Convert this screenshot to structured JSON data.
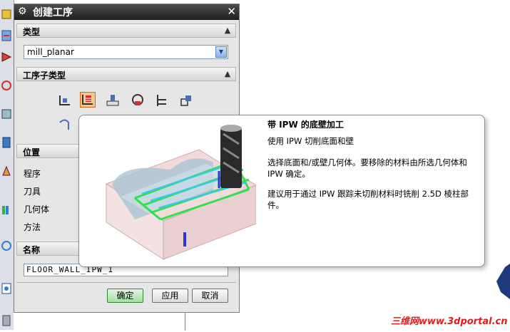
{
  "dialog": {
    "title": "创建工序",
    "type_section": {
      "label": "类型",
      "selected": "mill_planar"
    },
    "subtype_section": {
      "label": "工序子类型"
    },
    "location_section": {
      "label": "位置",
      "fields": [
        "程序",
        "刀具",
        "几何体",
        "方法"
      ]
    },
    "name_section": {
      "label": "名称",
      "value": "FLOOR_WALL_IPW_1"
    },
    "buttons": {
      "ok": "确定",
      "apply": "应用",
      "cancel": "取消"
    }
  },
  "tooltip": {
    "title": "带 IPW 的底壁加工",
    "line1": "使用 IPW 切削底面和壁",
    "line2": "选择底面和/或壁几何体。要移除的材料由所选几何体和 IPW 确定。",
    "line3": "建议用于通过 IPW 跟踪未切削材料时铣削 2.5D 棱柱部件。"
  },
  "watermark": "三维网www.3dportal.cn",
  "colors": {
    "titlebar": "#2b2b2b",
    "selected_subtype": "#f7c68b",
    "ok_button": "#a9dca9",
    "watermark": "#e21b1b"
  }
}
